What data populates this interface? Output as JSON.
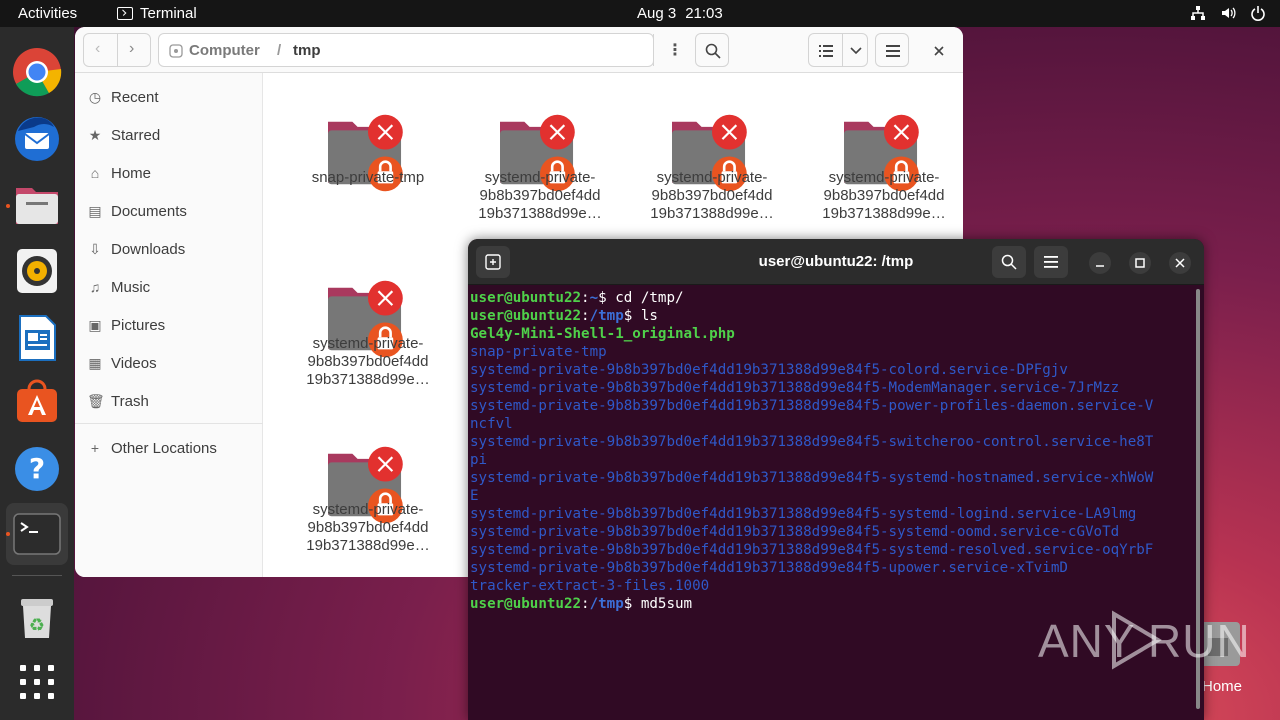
{
  "topbar": {
    "activities": "Activities",
    "app_name": "Terminal",
    "date": "Aug 3",
    "time": "21:03"
  },
  "dock": {
    "items": [
      "chrome-icon",
      "thunderbird-icon",
      "files-icon",
      "rhythmbox-icon",
      "writer-icon",
      "app-center-icon",
      "help-icon",
      "terminal-icon",
      "trash-icon",
      "show-apps-icon"
    ]
  },
  "files": {
    "path": {
      "root": "Computer",
      "sep": "/",
      "current": "tmp"
    },
    "sidebar": [
      {
        "label": "Recent",
        "icon": "clock-icon"
      },
      {
        "label": "Starred",
        "icon": "star-icon"
      },
      {
        "label": "Home",
        "icon": "home-icon"
      },
      {
        "label": "Documents",
        "icon": "document-icon"
      },
      {
        "label": "Downloads",
        "icon": "download-icon"
      },
      {
        "label": "Music",
        "icon": "music-icon"
      },
      {
        "label": "Pictures",
        "icon": "picture-icon"
      },
      {
        "label": "Videos",
        "icon": "video-icon"
      },
      {
        "label": "Trash",
        "icon": "trash-icon"
      },
      {
        "label": "Other Locations",
        "icon": "plus-icon"
      }
    ],
    "items": [
      {
        "l1": "snap-private-tmp",
        "l2": "",
        "l3": ""
      },
      {
        "l1": "systemd-private-",
        "l2": "9b8b397bd0ef4dd",
        "l3": "19b371388d99e…"
      },
      {
        "l1": "systemd-private-",
        "l2": "9b8b397bd0ef4dd",
        "l3": "19b371388d99e…"
      },
      {
        "l1": "systemd-private-",
        "l2": "9b8b397bd0ef4dd",
        "l3": "19b371388d99e…"
      },
      {
        "l1": "systemd-private-",
        "l2": "9b8b397bd0ef4dd",
        "l3": "19b371388d99e…"
      },
      {
        "l1": "systemd-private-",
        "l2": "9b8b397bd0ef4dd",
        "l3": "19b371388d99e…"
      }
    ]
  },
  "terminal": {
    "title": "user@ubuntu22: /tmp",
    "prompt_user": "user@ubuntu22",
    "lines": [
      {
        "dir": "~",
        "cmd": "cd /tmp/"
      },
      {
        "dir": "/tmp",
        "cmd": "ls"
      }
    ],
    "ls_green": "Gel4y-Mini-Shell-1_original.php",
    "ls_blue": [
      "snap-private-tmp",
      "systemd-private-9b8b397bd0ef4dd19b371388d99e84f5-colord.service-DPFgjv",
      "systemd-private-9b8b397bd0ef4dd19b371388d99e84f5-ModemManager.service-7JrMzz",
      "systemd-private-9b8b397bd0ef4dd19b371388d99e84f5-power-profiles-daemon.service-V",
      "ncfvl",
      "systemd-private-9b8b397bd0ef4dd19b371388d99e84f5-switcheroo-control.service-he8T",
      "pi",
      "systemd-private-9b8b397bd0ef4dd19b371388d99e84f5-systemd-hostnamed.service-xhWoW",
      "E",
      "systemd-private-9b8b397bd0ef4dd19b371388d99e84f5-systemd-logind.service-LA9lmg",
      "systemd-private-9b8b397bd0ef4dd19b371388d99e84f5-systemd-oomd.service-cGVoTd",
      "systemd-private-9b8b397bd0ef4dd19b371388d99e84f5-systemd-resolved.service-oqYrbF",
      "systemd-private-9b8b397bd0ef4dd19b371388d99e84f5-upower.service-xTvimD",
      "tracker-extract-3-files.1000"
    ],
    "last": {
      "dir": "/tmp",
      "cmd": "md5sum"
    }
  },
  "watermark": "ANY RUN",
  "desktop": {
    "home_label": "Home"
  }
}
